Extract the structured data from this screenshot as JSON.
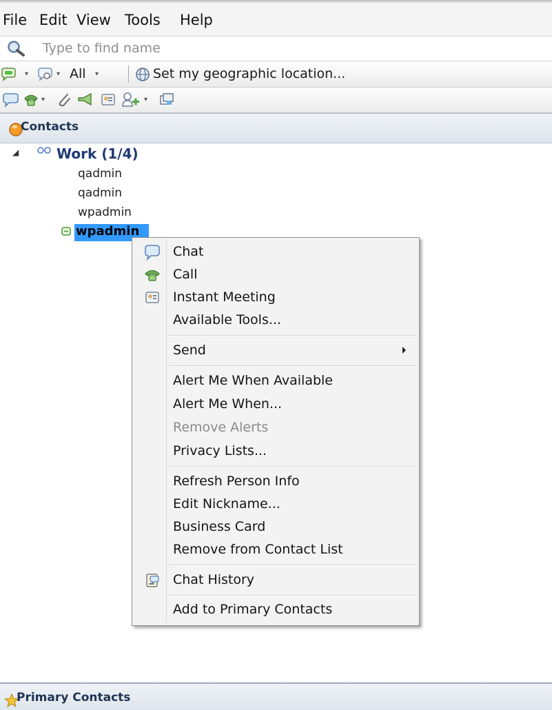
{
  "menubar": {
    "items": [
      "File",
      "Edit",
      "View",
      "Tools",
      "Help"
    ]
  },
  "search": {
    "placeholder": "Type to find name"
  },
  "status_row": {
    "filter_label": "All",
    "location_label": "Set my geographic location..."
  },
  "contacts_panel": {
    "title": "Contacts",
    "group": {
      "name": "Work (1/4)",
      "members": [
        "qadmin",
        "qadmin",
        "wpadmin",
        "wpadmin"
      ],
      "selected_index": 3
    }
  },
  "context_menu": {
    "items": [
      {
        "label": "Chat",
        "icon": "chat-icon"
      },
      {
        "label": "Call",
        "icon": "phone-icon"
      },
      {
        "label": "Instant Meeting",
        "icon": "meeting-icon"
      },
      {
        "label": "Available Tools..."
      },
      {
        "label": "Send",
        "submenu": true
      },
      {
        "label": "Alert Me When Available"
      },
      {
        "label": "Alert Me When..."
      },
      {
        "label": "Remove Alerts",
        "disabled": true
      },
      {
        "label": "Privacy Lists..."
      },
      {
        "label": "Refresh Person Info"
      },
      {
        "label": "Edit Nickname..."
      },
      {
        "label": "Business Card"
      },
      {
        "label": "Remove from Contact List"
      },
      {
        "label": "Chat History",
        "icon": "chat-history-icon"
      },
      {
        "label": "Add to Primary Contacts"
      }
    ]
  },
  "primary_panel": {
    "title": "Primary Contacts"
  },
  "colors": {
    "selection": "#3399ff",
    "header_text": "#1f3553",
    "group_text": "#1f3a73",
    "status_green": "#4fbf3f"
  }
}
